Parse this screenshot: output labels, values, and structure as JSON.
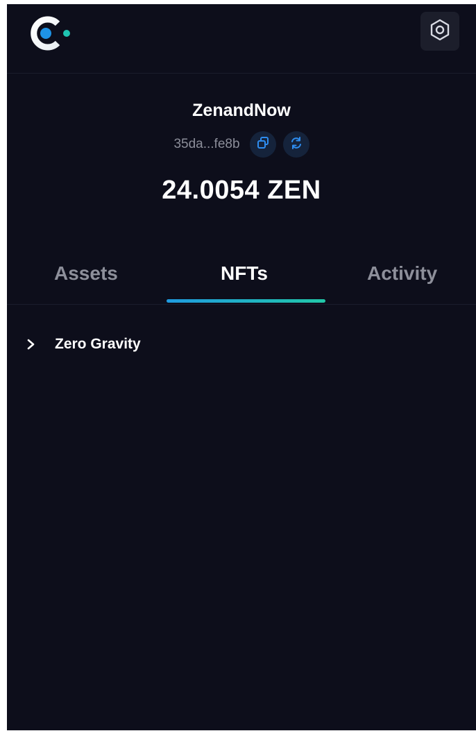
{
  "header": {
    "logo_icon": "celo-style-c-logo-icon",
    "settings_icon": "hexagon-gear-icon"
  },
  "account": {
    "name": "ZenandNow",
    "address_short": "35da...fe8b",
    "copy_icon": "copy-icon",
    "switch_icon": "refresh-icon",
    "balance": "24.0054 ZEN"
  },
  "tabs": [
    {
      "label": "Assets",
      "active": false
    },
    {
      "label": "NFTs",
      "active": true
    },
    {
      "label": "Activity",
      "active": false
    }
  ],
  "nfts": {
    "collections": [
      {
        "name": "Zero Gravity",
        "expanded": false,
        "icon": "chevron-right-icon"
      }
    ]
  },
  "colors": {
    "background": "#0d0e1b",
    "accent_start": "#1f9be0",
    "accent_end": "#21c7a8",
    "muted_text": "#8d8f9a"
  }
}
